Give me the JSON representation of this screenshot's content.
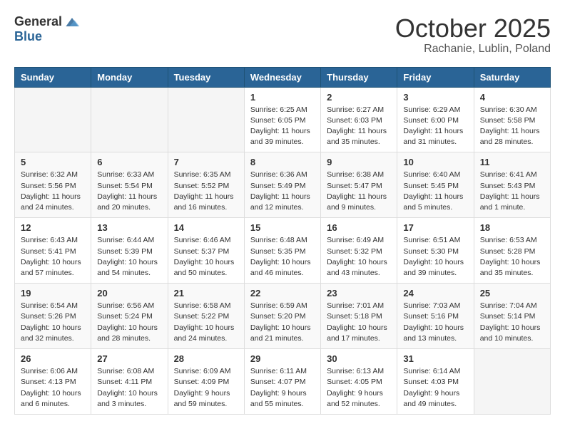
{
  "header": {
    "logo_general": "General",
    "logo_blue": "Blue",
    "month_title": "October 2025",
    "location": "Rachanie, Lublin, Poland"
  },
  "weekdays": [
    "Sunday",
    "Monday",
    "Tuesday",
    "Wednesday",
    "Thursday",
    "Friday",
    "Saturday"
  ],
  "weeks": [
    [
      {
        "day": "",
        "info": ""
      },
      {
        "day": "",
        "info": ""
      },
      {
        "day": "",
        "info": ""
      },
      {
        "day": "1",
        "info": "Sunrise: 6:25 AM\nSunset: 6:05 PM\nDaylight: 11 hours\nand 39 minutes."
      },
      {
        "day": "2",
        "info": "Sunrise: 6:27 AM\nSunset: 6:03 PM\nDaylight: 11 hours\nand 35 minutes."
      },
      {
        "day": "3",
        "info": "Sunrise: 6:29 AM\nSunset: 6:00 PM\nDaylight: 11 hours\nand 31 minutes."
      },
      {
        "day": "4",
        "info": "Sunrise: 6:30 AM\nSunset: 5:58 PM\nDaylight: 11 hours\nand 28 minutes."
      }
    ],
    [
      {
        "day": "5",
        "info": "Sunrise: 6:32 AM\nSunset: 5:56 PM\nDaylight: 11 hours\nand 24 minutes."
      },
      {
        "day": "6",
        "info": "Sunrise: 6:33 AM\nSunset: 5:54 PM\nDaylight: 11 hours\nand 20 minutes."
      },
      {
        "day": "7",
        "info": "Sunrise: 6:35 AM\nSunset: 5:52 PM\nDaylight: 11 hours\nand 16 minutes."
      },
      {
        "day": "8",
        "info": "Sunrise: 6:36 AM\nSunset: 5:49 PM\nDaylight: 11 hours\nand 12 minutes."
      },
      {
        "day": "9",
        "info": "Sunrise: 6:38 AM\nSunset: 5:47 PM\nDaylight: 11 hours\nand 9 minutes."
      },
      {
        "day": "10",
        "info": "Sunrise: 6:40 AM\nSunset: 5:45 PM\nDaylight: 11 hours\nand 5 minutes."
      },
      {
        "day": "11",
        "info": "Sunrise: 6:41 AM\nSunset: 5:43 PM\nDaylight: 11 hours\nand 1 minute."
      }
    ],
    [
      {
        "day": "12",
        "info": "Sunrise: 6:43 AM\nSunset: 5:41 PM\nDaylight: 10 hours\nand 57 minutes."
      },
      {
        "day": "13",
        "info": "Sunrise: 6:44 AM\nSunset: 5:39 PM\nDaylight: 10 hours\nand 54 minutes."
      },
      {
        "day": "14",
        "info": "Sunrise: 6:46 AM\nSunset: 5:37 PM\nDaylight: 10 hours\nand 50 minutes."
      },
      {
        "day": "15",
        "info": "Sunrise: 6:48 AM\nSunset: 5:35 PM\nDaylight: 10 hours\nand 46 minutes."
      },
      {
        "day": "16",
        "info": "Sunrise: 6:49 AM\nSunset: 5:32 PM\nDaylight: 10 hours\nand 43 minutes."
      },
      {
        "day": "17",
        "info": "Sunrise: 6:51 AM\nSunset: 5:30 PM\nDaylight: 10 hours\nand 39 minutes."
      },
      {
        "day": "18",
        "info": "Sunrise: 6:53 AM\nSunset: 5:28 PM\nDaylight: 10 hours\nand 35 minutes."
      }
    ],
    [
      {
        "day": "19",
        "info": "Sunrise: 6:54 AM\nSunset: 5:26 PM\nDaylight: 10 hours\nand 32 minutes."
      },
      {
        "day": "20",
        "info": "Sunrise: 6:56 AM\nSunset: 5:24 PM\nDaylight: 10 hours\nand 28 minutes."
      },
      {
        "day": "21",
        "info": "Sunrise: 6:58 AM\nSunset: 5:22 PM\nDaylight: 10 hours\nand 24 minutes."
      },
      {
        "day": "22",
        "info": "Sunrise: 6:59 AM\nSunset: 5:20 PM\nDaylight: 10 hours\nand 21 minutes."
      },
      {
        "day": "23",
        "info": "Sunrise: 7:01 AM\nSunset: 5:18 PM\nDaylight: 10 hours\nand 17 minutes."
      },
      {
        "day": "24",
        "info": "Sunrise: 7:03 AM\nSunset: 5:16 PM\nDaylight: 10 hours\nand 13 minutes."
      },
      {
        "day": "25",
        "info": "Sunrise: 7:04 AM\nSunset: 5:14 PM\nDaylight: 10 hours\nand 10 minutes."
      }
    ],
    [
      {
        "day": "26",
        "info": "Sunrise: 6:06 AM\nSunset: 4:13 PM\nDaylight: 10 hours\nand 6 minutes."
      },
      {
        "day": "27",
        "info": "Sunrise: 6:08 AM\nSunset: 4:11 PM\nDaylight: 10 hours\nand 3 minutes."
      },
      {
        "day": "28",
        "info": "Sunrise: 6:09 AM\nSunset: 4:09 PM\nDaylight: 9 hours\nand 59 minutes."
      },
      {
        "day": "29",
        "info": "Sunrise: 6:11 AM\nSunset: 4:07 PM\nDaylight: 9 hours\nand 55 minutes."
      },
      {
        "day": "30",
        "info": "Sunrise: 6:13 AM\nSunset: 4:05 PM\nDaylight: 9 hours\nand 52 minutes."
      },
      {
        "day": "31",
        "info": "Sunrise: 6:14 AM\nSunset: 4:03 PM\nDaylight: 9 hours\nand 49 minutes."
      },
      {
        "day": "",
        "info": ""
      }
    ]
  ]
}
